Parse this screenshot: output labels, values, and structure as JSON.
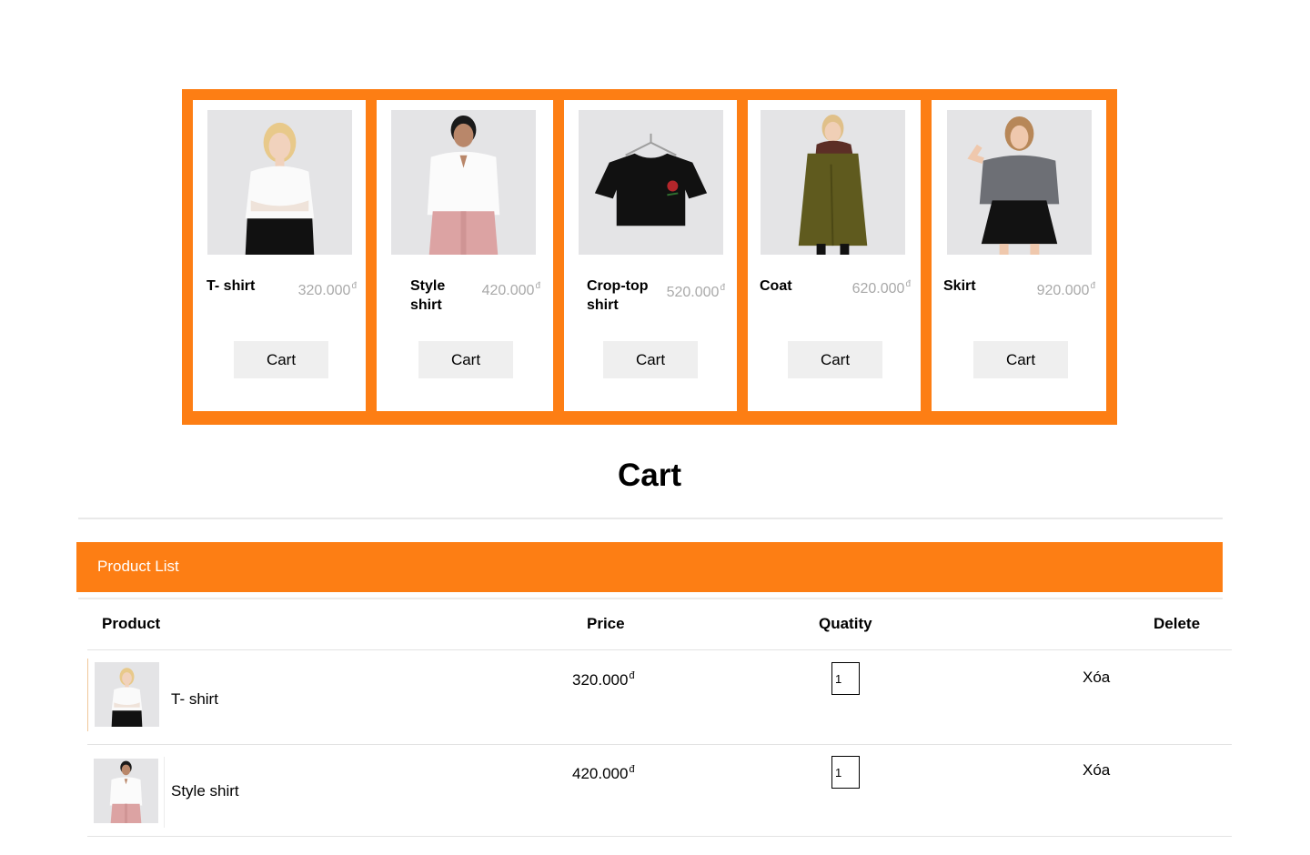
{
  "products": [
    {
      "name": "T- shirt",
      "price": "320.000",
      "currency": "đ",
      "cart_label": "Cart",
      "image": "woman-white-tshirt-photo"
    },
    {
      "name": "Style shirt",
      "price": "420.000",
      "currency": "đ",
      "cart_label": "Cart",
      "image": "woman-white-shirt-pink-pants-photo"
    },
    {
      "name": "Crop-top shirt",
      "price": "520.000",
      "currency": "đ",
      "cart_label": "Cart",
      "image": "black-crop-top-hanger-photo"
    },
    {
      "name": "Coat",
      "price": "620.000",
      "currency": "đ",
      "cart_label": "Cart",
      "image": "woman-olive-coat-photo"
    },
    {
      "name": "Skirt",
      "price": "920.000",
      "currency": "đ",
      "cart_label": "Cart",
      "image": "woman-grey-top-black-skirt-photo"
    }
  ],
  "cart": {
    "title": "Cart",
    "panel_title": "Product List",
    "columns": {
      "product": "Product",
      "price": "Price",
      "quantity": "Quatity",
      "delete": "Delete"
    },
    "rows": [
      {
        "name": "T- shirt",
        "price": "320.000",
        "currency": "đ",
        "quantity": "1",
        "delete_label": "Xóa"
      },
      {
        "name": "Style shirt",
        "price": "420.000",
        "currency": "đ",
        "quantity": "1",
        "delete_label": "Xóa"
      }
    ]
  },
  "colors": {
    "accent": "#fd7e14",
    "button_bg": "#efefef",
    "price_muted": "#a9a9a9"
  }
}
